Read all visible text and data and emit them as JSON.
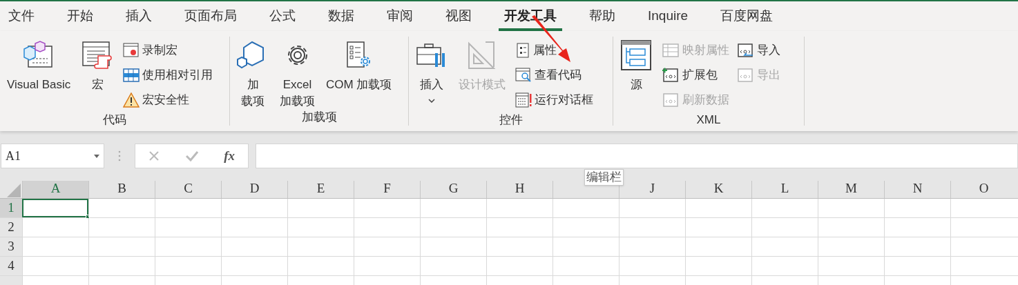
{
  "tabs": [
    {
      "label": "文件",
      "selected": false
    },
    {
      "label": "开始",
      "selected": false
    },
    {
      "label": "插入",
      "selected": false
    },
    {
      "label": "页面布局",
      "selected": false
    },
    {
      "label": "公式",
      "selected": false
    },
    {
      "label": "数据",
      "selected": false
    },
    {
      "label": "审阅",
      "selected": false
    },
    {
      "label": "视图",
      "selected": false
    },
    {
      "label": "开发工具",
      "selected": true
    },
    {
      "label": "帮助",
      "selected": false
    },
    {
      "label": "Inquire",
      "selected": false
    },
    {
      "label": "百度网盘",
      "selected": false
    }
  ],
  "ribbon": {
    "groups": [
      {
        "label": "代码",
        "controls": [
          {
            "kind": "large",
            "lines": [
              "Visual Basic"
            ],
            "disabled": false
          },
          {
            "kind": "large",
            "lines": [
              "宏"
            ],
            "disabled": false
          },
          {
            "kind": "stack",
            "items": [
              {
                "label": "录制宏",
                "disabled": false
              },
              {
                "label": "使用相对引用",
                "disabled": false
              },
              {
                "label": "宏安全性",
                "disabled": false
              }
            ]
          }
        ]
      },
      {
        "label": "加载项",
        "controls": [
          {
            "kind": "large",
            "lines": [
              "加",
              "载项"
            ],
            "disabled": false
          },
          {
            "kind": "large",
            "lines": [
              "Excel",
              "加载项"
            ],
            "disabled": false
          },
          {
            "kind": "large",
            "lines": [
              "COM 加载项"
            ],
            "disabled": false
          }
        ]
      },
      {
        "label": "控件",
        "controls": [
          {
            "kind": "large",
            "lines": [
              "插入"
            ],
            "disabled": false,
            "dropdown": true
          },
          {
            "kind": "large",
            "lines": [
              "设计模式"
            ],
            "disabled": true
          },
          {
            "kind": "stack",
            "items": [
              {
                "label": "属性",
                "disabled": false
              },
              {
                "label": "查看代码",
                "disabled": false
              },
              {
                "label": "运行对话框",
                "disabled": false
              }
            ]
          }
        ]
      },
      {
        "label": "XML",
        "controls": [
          {
            "kind": "large",
            "lines": [
              "源"
            ],
            "disabled": false
          },
          {
            "kind": "stack",
            "items": [
              {
                "label": "映射属性",
                "disabled": true
              },
              {
                "label": "扩展包",
                "disabled": false
              },
              {
                "label": "刷新数据",
                "disabled": true
              }
            ]
          },
          {
            "kind": "stack",
            "items": [
              {
                "label": "导入",
                "disabled": false
              },
              {
                "label": "导出",
                "disabled": true
              }
            ]
          }
        ]
      }
    ]
  },
  "formula_bar": {
    "name_box": "A1",
    "function_button": "fx",
    "tooltip": "编辑栏"
  },
  "sheet": {
    "columns": [
      {
        "label": "A",
        "selected": true
      },
      {
        "label": "B",
        "selected": false
      },
      {
        "label": "C",
        "selected": false
      },
      {
        "label": "D",
        "selected": false
      },
      {
        "label": "E",
        "selected": false
      },
      {
        "label": "F",
        "selected": false
      },
      {
        "label": "G",
        "selected": false
      },
      {
        "label": "H",
        "selected": false
      },
      {
        "selected": false
      },
      {
        "label": "J",
        "selected": false
      },
      {
        "label": "K",
        "selected": false
      },
      {
        "label": "L",
        "selected": false
      },
      {
        "label": "M",
        "selected": false
      },
      {
        "label": "N",
        "selected": false
      },
      {
        "label": "O",
        "selected": false
      }
    ],
    "rows": [
      {
        "label": "1",
        "selected": true
      },
      {
        "label": "2",
        "selected": false
      },
      {
        "label": "3",
        "selected": false
      },
      {
        "label": "4",
        "selected": false
      }
    ]
  }
}
